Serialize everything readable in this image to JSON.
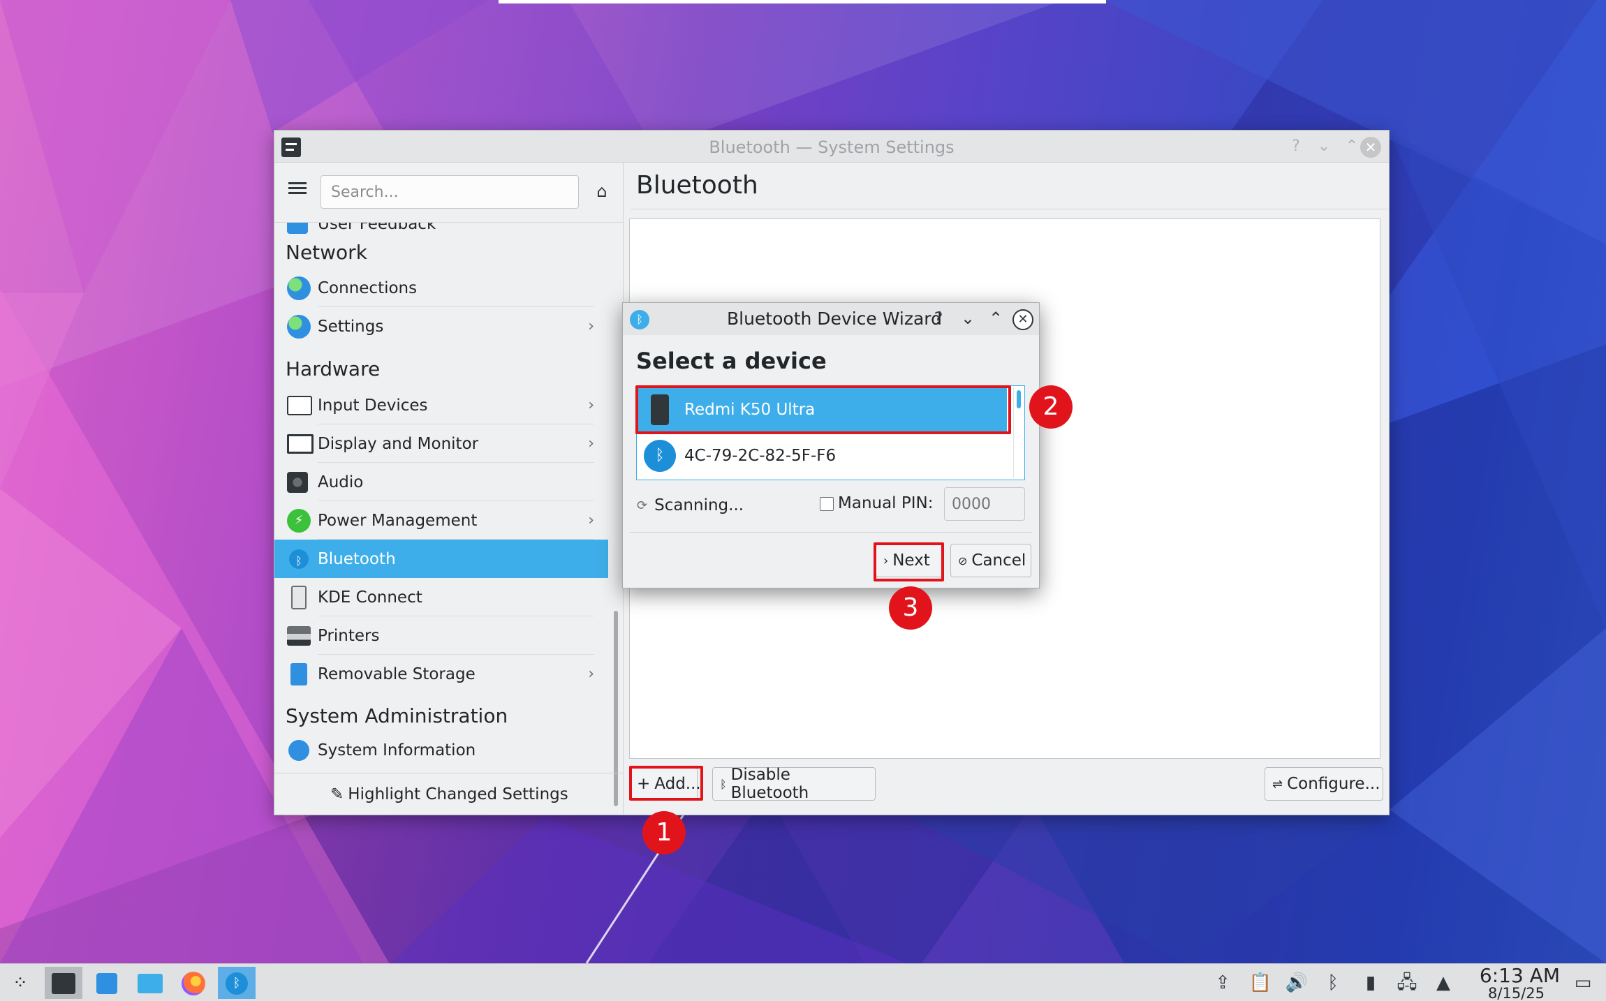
{
  "window": {
    "title": "Bluetooth — System Settings",
    "help_glyph": "?",
    "minimize_glyph": "⌄",
    "maximize_glyph": "⌃",
    "close_glyph": "✕"
  },
  "sidebar": {
    "search_placeholder": "Search...",
    "items": [
      {
        "label": "User Feedback",
        "type": "item"
      },
      {
        "label": "Network",
        "type": "category"
      },
      {
        "label": "Connections",
        "type": "item"
      },
      {
        "label": "Settings",
        "type": "item",
        "chevron": "›"
      },
      {
        "label": "Hardware",
        "type": "category"
      },
      {
        "label": "Input Devices",
        "type": "item",
        "chevron": "›"
      },
      {
        "label": "Display and Monitor",
        "type": "item",
        "chevron": "›"
      },
      {
        "label": "Audio",
        "type": "item"
      },
      {
        "label": "Power Management",
        "type": "item",
        "chevron": "›"
      },
      {
        "label": "Bluetooth",
        "type": "item",
        "selected": true
      },
      {
        "label": "KDE Connect",
        "type": "item"
      },
      {
        "label": "Printers",
        "type": "item"
      },
      {
        "label": "Removable Storage",
        "type": "item",
        "chevron": "›"
      },
      {
        "label": "System Administration",
        "type": "category"
      },
      {
        "label": "System Information",
        "type": "item"
      }
    ],
    "highlight_button": "Highlight Changed Settings"
  },
  "main": {
    "page_title": "Bluetooth",
    "add_button": "Add...",
    "disable_button": "Disable Bluetooth",
    "configure_button": "Configure..."
  },
  "wizard": {
    "title": "Bluetooth Device Wizard",
    "heading": "Select a device",
    "devices": [
      {
        "name": "Redmi K50 Ultra",
        "selected": true,
        "icon": "phone-icon"
      },
      {
        "name": "4C-79-2C-82-5F-F6",
        "selected": false,
        "icon": "bluetooth-icon"
      }
    ],
    "scanning_text": "Scanning...",
    "manual_pin_label": "Manual PIN:",
    "pin_placeholder": "0000",
    "next_button": "Next",
    "cancel_button": "Cancel"
  },
  "annotations": [
    {
      "number": "1",
      "target": "add-button"
    },
    {
      "number": "2",
      "target": "device-redmi"
    },
    {
      "number": "3",
      "target": "next-button"
    }
  ],
  "taskbar": {
    "time": "6:13 AM",
    "date": "8/15/25"
  },
  "colors": {
    "accent": "#3daee9",
    "annotation_red": "#e2141b"
  }
}
